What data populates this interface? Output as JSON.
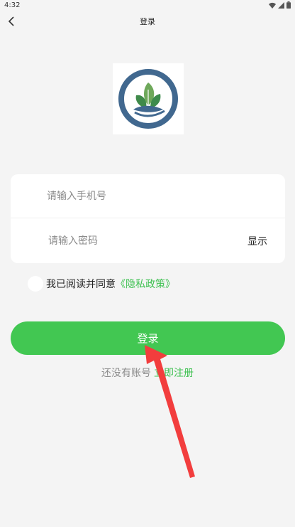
{
  "status_bar": {
    "time": "4:32"
  },
  "nav": {
    "title": "登录"
  },
  "logo": {
    "alt": "logo"
  },
  "form": {
    "phone_placeholder": "请输入手机号",
    "phone_value": "",
    "password_placeholder": "请输入密码",
    "password_value": "",
    "show_password_label": "显示"
  },
  "agreement": {
    "text": "我已阅读并同意",
    "link": "《隐私政策》"
  },
  "login_button": {
    "label": "登录"
  },
  "register": {
    "prompt": "还没有账号",
    "link": "立即注册"
  },
  "colors": {
    "accent": "#42c752",
    "link": "#3cc04f",
    "annotation_arrow": "#f23d3d"
  }
}
